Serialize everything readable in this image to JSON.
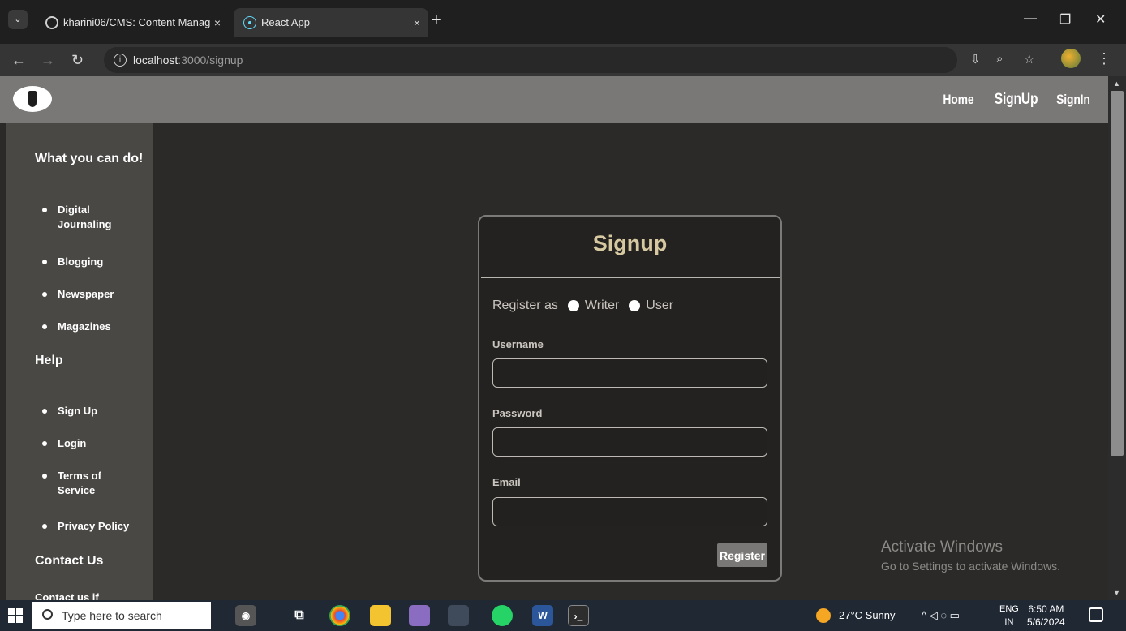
{
  "browser": {
    "tabs": [
      {
        "title": "kharini06/CMS: Content Manag",
        "close": "×"
      },
      {
        "title": "React App",
        "close": "×"
      }
    ],
    "new_tab": "+",
    "url_host": "localhost",
    "url_path": ":3000/signup"
  },
  "header": {
    "nav": [
      "Home",
      "SignUp",
      "SignIn"
    ]
  },
  "sidebar": {
    "section1_title": "What you can do!",
    "section1_items": [
      "Digital Journaling",
      "Blogging",
      "Newspaper",
      "Magazines"
    ],
    "section2_title": "Help",
    "section2_items": [
      "Sign Up",
      "Login",
      "Terms of Service",
      "Privacy Policy"
    ],
    "section3_title": "Contact Us",
    "section3_partial": "Contact us if"
  },
  "signup": {
    "title": "Signup",
    "register_as": "Register as",
    "roles": [
      "Writer",
      "User"
    ],
    "username_label": "Username",
    "password_label": "Password",
    "email_label": "Email",
    "username_value": "",
    "password_value": "",
    "email_value": "",
    "register_button": "Register"
  },
  "watermark": {
    "line1": "Activate Windows",
    "line2": "Go to Settings to activate Windows."
  },
  "taskbar": {
    "search_placeholder": "Type here to search",
    "weather": "27°C  Sunny",
    "lang_top": "ENG",
    "lang_bottom": "IN",
    "time": "6:50 AM",
    "date": "5/6/2024"
  }
}
